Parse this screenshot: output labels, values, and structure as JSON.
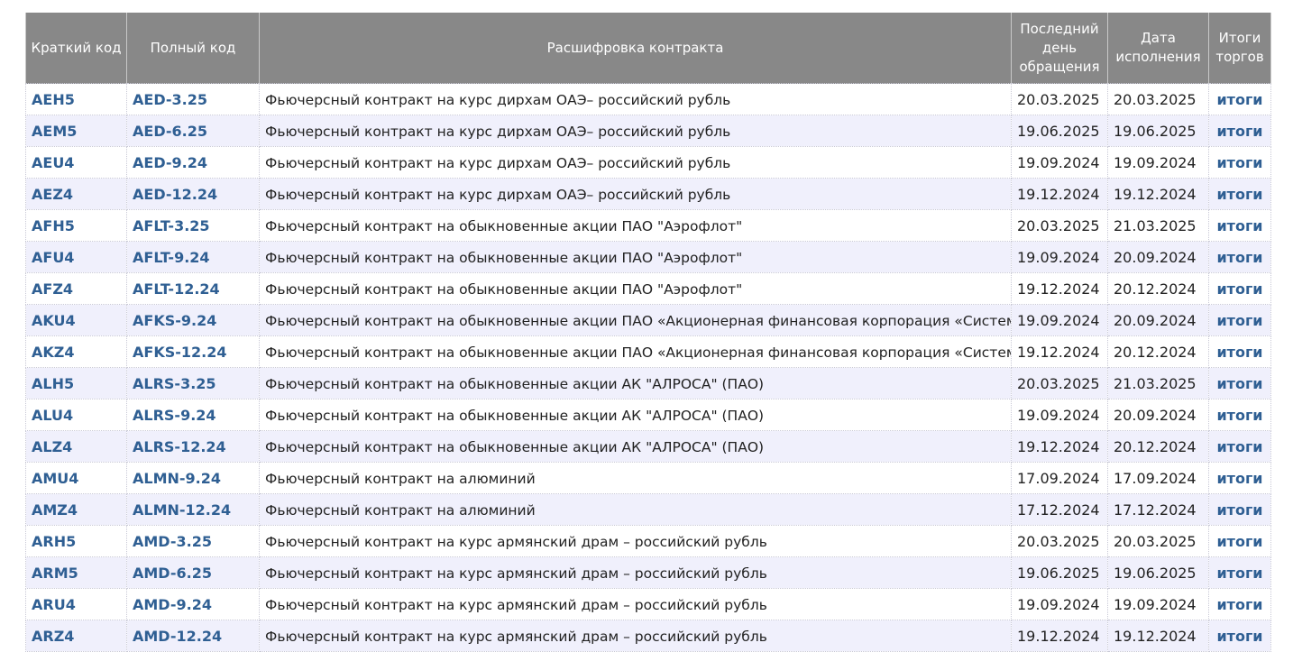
{
  "table": {
    "headers": {
      "short_code": "Краткий код",
      "full_code": "Полный код",
      "description": "Расшифровка контракта",
      "last_day": "Последний день обращения",
      "exec_date": "Дата исполнения",
      "results": "Итоги торгов"
    },
    "rows": [
      {
        "short": "AEH5",
        "full": "AED-3.25",
        "desc": "Фьючерсный контракт на курс дирхам ОАЭ– российский рубль",
        "last": "20.03.2025",
        "exec": "20.03.2025",
        "res": "итоги"
      },
      {
        "short": "AEM5",
        "full": "AED-6.25",
        "desc": "Фьючерсный контракт на курс дирхам ОАЭ– российский рубль",
        "last": "19.06.2025",
        "exec": "19.06.2025",
        "res": "итоги"
      },
      {
        "short": "AEU4",
        "full": "AED-9.24",
        "desc": "Фьючерсный контракт на курс дирхам ОАЭ– российский рубль",
        "last": "19.09.2024",
        "exec": "19.09.2024",
        "res": "итоги"
      },
      {
        "short": "AEZ4",
        "full": "AED-12.24",
        "desc": "Фьючерсный контракт на курс дирхам ОАЭ– российский рубль",
        "last": "19.12.2024",
        "exec": "19.12.2024",
        "res": "итоги"
      },
      {
        "short": "AFH5",
        "full": "AFLT-3.25",
        "desc": "Фьючерсный контракт на обыкновенные акции ПАО \"Аэрофлот\"",
        "last": "20.03.2025",
        "exec": "21.03.2025",
        "res": "итоги"
      },
      {
        "short": "AFU4",
        "full": "AFLT-9.24",
        "desc": "Фьючерсный контракт на обыкновенные акции ПАО \"Аэрофлот\"",
        "last": "19.09.2024",
        "exec": "20.09.2024",
        "res": "итоги"
      },
      {
        "short": "AFZ4",
        "full": "AFLT-12.24",
        "desc": "Фьючерсный контракт на обыкновенные акции ПАО \"Аэрофлот\"",
        "last": "19.12.2024",
        "exec": "20.12.2024",
        "res": "итоги"
      },
      {
        "short": "AKU4",
        "full": "AFKS-9.24",
        "desc": "Фьючерсный контракт на обыкновенные акции ПАО «Акционерная финансовая корпорация «Система»",
        "last": "19.09.2024",
        "exec": "20.09.2024",
        "res": "итоги"
      },
      {
        "short": "AKZ4",
        "full": "AFKS-12.24",
        "desc": "Фьючерсный контракт на обыкновенные акции ПАО «Акционерная финансовая корпорация «Система»",
        "last": "19.12.2024",
        "exec": "20.12.2024",
        "res": "итоги"
      },
      {
        "short": "ALH5",
        "full": "ALRS-3.25",
        "desc": "Фьючерсный контракт на обыкновенные акции АК \"АЛРОСА\" (ПАО)",
        "last": "20.03.2025",
        "exec": "21.03.2025",
        "res": "итоги"
      },
      {
        "short": "ALU4",
        "full": "ALRS-9.24",
        "desc": "Фьючерсный контракт на обыкновенные акции АК \"АЛРОСА\" (ПАО)",
        "last": "19.09.2024",
        "exec": "20.09.2024",
        "res": "итоги"
      },
      {
        "short": "ALZ4",
        "full": "ALRS-12.24",
        "desc": "Фьючерсный контракт на обыкновенные акции АК \"АЛРОСА\" (ПАО)",
        "last": "19.12.2024",
        "exec": "20.12.2024",
        "res": "итоги"
      },
      {
        "short": "AMU4",
        "full": "ALMN-9.24",
        "desc": "Фьючерсный контракт на алюминий",
        "last": "17.09.2024",
        "exec": "17.09.2024",
        "res": "итоги"
      },
      {
        "short": "AMZ4",
        "full": "ALMN-12.24",
        "desc": "Фьючерсный контракт на алюминий",
        "last": "17.12.2024",
        "exec": "17.12.2024",
        "res": "итоги"
      },
      {
        "short": "ARH5",
        "full": "AMD-3.25",
        "desc": "Фьючерсный контракт на курс армянский драм – российский рубль",
        "last": "20.03.2025",
        "exec": "20.03.2025",
        "res": "итоги"
      },
      {
        "short": "ARM5",
        "full": "AMD-6.25",
        "desc": "Фьючерсный контракт на курс армянский драм – российский рубль",
        "last": "19.06.2025",
        "exec": "19.06.2025",
        "res": "итоги"
      },
      {
        "short": "ARU4",
        "full": "AMD-9.24",
        "desc": "Фьючерсный контракт на курс армянский драм – российский рубль",
        "last": "19.09.2024",
        "exec": "19.09.2024",
        "res": "итоги"
      },
      {
        "short": "ARZ4",
        "full": "AMD-12.24",
        "desc": "Фьючерсный контракт на курс армянский драм – российский рубль",
        "last": "19.12.2024",
        "exec": "19.12.2024",
        "res": "итоги"
      }
    ]
  }
}
